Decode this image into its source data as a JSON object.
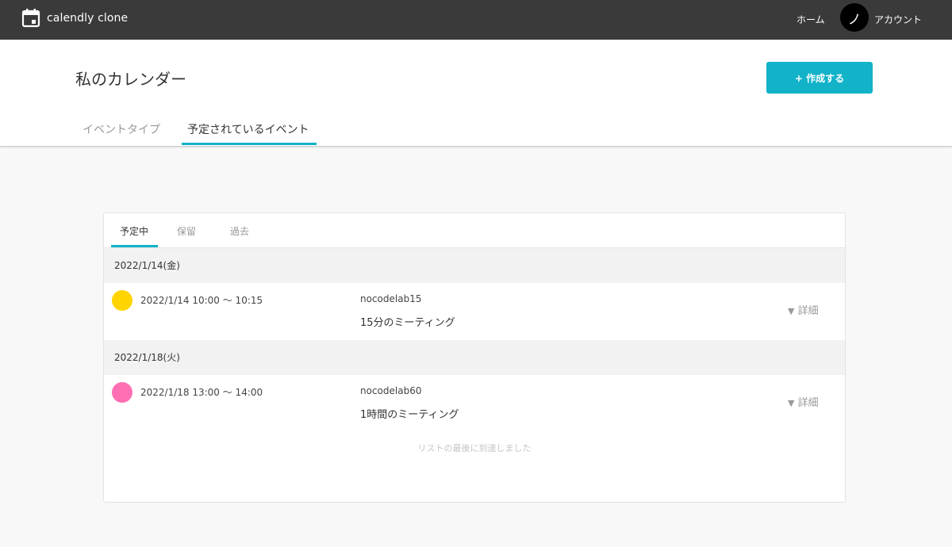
{
  "topbar": {
    "brand": "calendly clone",
    "home": "ホーム",
    "avatar_char": "ノ",
    "account": "アカウント",
    "brand_icon": "calendar-icon"
  },
  "header": {
    "title": "私のカレンダー",
    "create_button": "+ 作成する",
    "tabs": [
      {
        "label": "イベントタイプ",
        "active": false
      },
      {
        "label": "予定されているイベント",
        "active": true
      }
    ]
  },
  "card": {
    "subtabs": [
      {
        "label": "予定中",
        "active": true
      },
      {
        "label": "保留",
        "active": false
      },
      {
        "label": "過去",
        "active": false
      }
    ],
    "groups": [
      {
        "date": "2022/1/14(金)",
        "events": [
          {
            "color": "#ffd400",
            "time": "2022/1/14 10:00 〜 10:15",
            "user": "nocodelab15",
            "title": "15分のミーティング",
            "detail": "詳細"
          }
        ]
      },
      {
        "date": "2022/1/18(火)",
        "events": [
          {
            "color": "#ff6fb3",
            "time": "2022/1/18 13:00 〜 14:00",
            "user": "nocodelab60",
            "title": "1時間のミーティング",
            "detail": "詳細"
          }
        ]
      }
    ],
    "end_message": "リストの最後に到達しました"
  },
  "colors": {
    "accent": "#12b3c9",
    "topbar": "#3a3a3a"
  }
}
